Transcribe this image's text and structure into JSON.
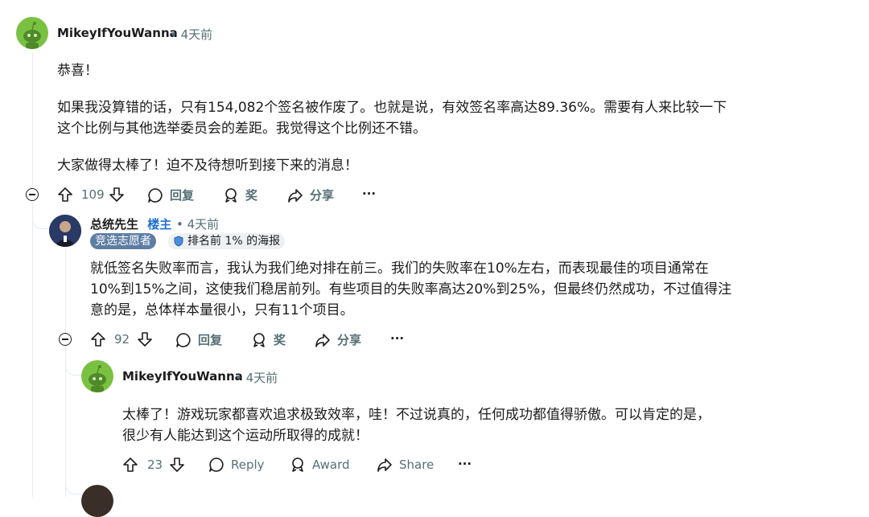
{
  "comments": [
    {
      "username": "MikeyIfYouWanna",
      "meta": "• 4天前",
      "paragraphs": [
        "恭喜！",
        "如果我没算错的话，只有154,082个签名被作废了。也就是说，有效签名率高达89.36%。需要有人来比较一下这个比例与其他选举委员会的差距。我觉得这个比例还不错。",
        "大家做得太棒了！迫不及待想听到接下来的消息！"
      ],
      "votes": "109",
      "actions": {
        "reply": "回复",
        "award": "奖",
        "share": "分享",
        "more": "···"
      }
    },
    {
      "username": "总统先生",
      "op_badge": "楼主",
      "meta": "• 4天前",
      "flair_user": "竞选志愿者",
      "flair_rank": "排名前 1% 的海报",
      "paragraph": "就低签名失败率而言，我认为我们绝对排在前三。我们的失败率在10%左右，而表现最佳的项目通常在10%到15%之间，这使我们稳居前列。有些项目的失败率高达20%到25%，但最终仍然成功，不过值得注意的是，总体样本量很小，只有11个项目。",
      "votes": "92",
      "actions": {
        "reply": "回复",
        "award": "奖",
        "share": "分享",
        "more": "···"
      }
    },
    {
      "username": "MikeyIfYouWanna",
      "meta": "• 4天前",
      "paragraph": "太棒了！游戏玩家都喜欢追求极致效率，哇！不过说真的，任何成功都值得骄傲。可以肯定的是，很少有人能达到这个运动所取得的成就！",
      "votes": "23",
      "actions": {
        "reply": "Reply",
        "award": "Award",
        "share": "Share",
        "more": "···"
      }
    }
  ],
  "icons": {
    "upvote": "arrow-up-outline-icon",
    "downvote": "arrow-down-outline-icon",
    "reply": "speech-bubble-icon",
    "award": "award-ribbon-icon",
    "share": "share-arrow-icon",
    "more": "ellipsis-icon",
    "collapse": "minus-circle-icon",
    "rank": "shield-rank-icon"
  },
  "colors": {
    "op_badge": "#1f6fd1",
    "flair_user_bg": "#5e7da3",
    "avatar_green": "#7ac142",
    "meta_text": "#576f76"
  }
}
